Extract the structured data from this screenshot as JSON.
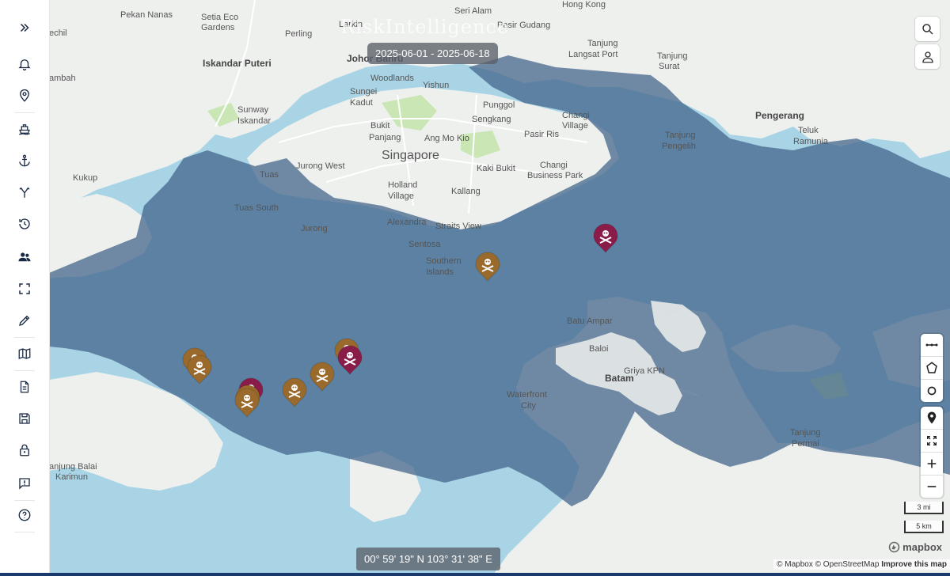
{
  "app": {
    "brand_watermark": "RiskIntelligence"
  },
  "filter": {
    "date_range": "2025-06-01 - 2025-06-18"
  },
  "sidebar": {
    "items": [
      {
        "name": "expand",
        "icon": "chevrons-right-icon"
      },
      {
        "name": "alerts",
        "icon": "bell-icon"
      },
      {
        "name": "locations",
        "icon": "map-pin-icon"
      },
      {
        "name": "vessels",
        "icon": "ship-icon"
      },
      {
        "name": "ports",
        "icon": "anchor-icon"
      },
      {
        "name": "routes",
        "icon": "branch-icon"
      },
      {
        "name": "history",
        "icon": "history-icon"
      },
      {
        "name": "users",
        "icon": "users-icon"
      },
      {
        "name": "fullscreen",
        "icon": "fullscreen-icon"
      },
      {
        "name": "draw",
        "icon": "pencil-icon"
      },
      {
        "name": "maps",
        "icon": "map-icon"
      },
      {
        "name": "reports",
        "icon": "document-icon"
      },
      {
        "name": "save",
        "icon": "save-icon"
      },
      {
        "name": "lock",
        "icon": "lock-icon"
      },
      {
        "name": "feedback",
        "icon": "feedback-icon"
      },
      {
        "name": "help",
        "icon": "help-icon"
      }
    ]
  },
  "map": {
    "place_labels": [
      {
        "text": "Pekan Nanas",
        "style": "normal"
      },
      {
        "text": "Setia Eco",
        "style": "normal"
      },
      {
        "text": "Gardens",
        "style": "normal"
      },
      {
        "text": "Larkin",
        "style": "normal"
      },
      {
        "text": "Seri Alam",
        "style": "normal"
      },
      {
        "text": "Pasir Gudang",
        "style": "normal"
      },
      {
        "text": "Hong Kong",
        "style": "normal"
      },
      {
        "text": "echil",
        "style": "normal"
      },
      {
        "text": "Perling",
        "style": "normal"
      },
      {
        "text": "Iskandar Puteri",
        "style": "bold"
      },
      {
        "text": "Johor Bahru",
        "style": "bold"
      },
      {
        "text": "Tanjung",
        "style": "normal"
      },
      {
        "text": "Langsat Port",
        "style": "normal"
      },
      {
        "text": "Tanjung",
        "style": "normal"
      },
      {
        "text": "Surat",
        "style": "normal"
      },
      {
        "text": "ambah",
        "style": "normal"
      },
      {
        "text": "Woodlands",
        "style": "normal"
      },
      {
        "text": "Yishun",
        "style": "normal"
      },
      {
        "text": "Sungei",
        "style": "normal"
      },
      {
        "text": "Kadut",
        "style": "normal"
      },
      {
        "text": "Punggol",
        "style": "normal"
      },
      {
        "text": "Sunway",
        "style": "normal"
      },
      {
        "text": "Iskandar",
        "style": "normal"
      },
      {
        "text": "Sengkang",
        "style": "normal"
      },
      {
        "text": "Changi",
        "style": "normal"
      },
      {
        "text": "Village",
        "style": "normal"
      },
      {
        "text": "Pengerang",
        "style": "bold"
      },
      {
        "text": "Bukit",
        "style": "normal"
      },
      {
        "text": "Panjang",
        "style": "normal"
      },
      {
        "text": "Ang Mo Kio",
        "style": "normal"
      },
      {
        "text": "Pasir Ris",
        "style": "normal"
      },
      {
        "text": "Teluk",
        "style": "normal"
      },
      {
        "text": "Ramunia",
        "style": "normal"
      },
      {
        "text": "Tanjung",
        "style": "normal"
      },
      {
        "text": "Pengelih",
        "style": "normal"
      },
      {
        "text": "Singapore",
        "style": "big"
      },
      {
        "text": "Jurong West",
        "style": "normal"
      },
      {
        "text": "Kaki Bukit",
        "style": "normal"
      },
      {
        "text": "Changi",
        "style": "normal"
      },
      {
        "text": "Business Park",
        "style": "normal"
      },
      {
        "text": "Kukup",
        "style": "normal"
      },
      {
        "text": "Tuas",
        "style": "normal"
      },
      {
        "text": "Holland",
        "style": "normal"
      },
      {
        "text": "Village",
        "style": "normal"
      },
      {
        "text": "Kallang",
        "style": "normal"
      },
      {
        "text": "Tuas South",
        "style": "normal"
      },
      {
        "text": "Jurong",
        "style": "normal"
      },
      {
        "text": "Alexandra",
        "style": "normal"
      },
      {
        "text": "Straits View",
        "style": "normal"
      },
      {
        "text": "Sentosa",
        "style": "normal"
      },
      {
        "text": "Southern",
        "style": "normal"
      },
      {
        "text": "Islands",
        "style": "normal"
      },
      {
        "text": "Batu Ampar",
        "style": "normal"
      },
      {
        "text": "Baloi",
        "style": "normal"
      },
      {
        "text": "Griya KPN",
        "style": "normal"
      },
      {
        "text": "Batam",
        "style": "bold"
      },
      {
        "text": "Waterfront",
        "style": "normal"
      },
      {
        "text": "City",
        "style": "normal"
      },
      {
        "text": "Tanjung",
        "style": "normal"
      },
      {
        "text": "Permai",
        "style": "normal"
      },
      {
        "text": "anjung Balai",
        "style": "normal"
      },
      {
        "text": "Karimun",
        "style": "normal"
      }
    ],
    "incident_markers": [
      {
        "type": "piracy",
        "color": "#8a1c4a"
      },
      {
        "type": "piracy",
        "color": "#9a6a2c"
      },
      {
        "type": "piracy",
        "color": "#9a6a2c"
      },
      {
        "type": "piracy",
        "color": "#9a6a2c"
      },
      {
        "type": "piracy",
        "color": "#8a1c4a"
      },
      {
        "type": "piracy",
        "color": "#9a6a2c"
      },
      {
        "type": "piracy",
        "color": "#9a6a2c"
      },
      {
        "type": "piracy",
        "color": "#9a6a2c"
      },
      {
        "type": "piracy",
        "color": "#8a1c4a"
      },
      {
        "type": "piracy",
        "color": "#9a6a2c"
      },
      {
        "type": "piracy",
        "color": "#9a6a2c"
      }
    ],
    "colors": {
      "water": "#a8d4e6",
      "land": "#eef0ee",
      "risk_zone": "#5a7a99",
      "park": "#c9e6b4",
      "marker_high": "#8a1c4a",
      "marker_medium": "#9a6a2c"
    }
  },
  "controls": {
    "search_icon": "search-icon",
    "user_icon": "user-icon",
    "measure_tools": [
      "measure-line-icon",
      "polygon-icon",
      "circle-icon"
    ],
    "nav_tools": [
      "locate-pin-icon",
      "fit-bounds-icon",
      "zoom-in-icon",
      "zoom-out-icon"
    ]
  },
  "scale": {
    "imperial": "3 mi",
    "metric": "5 km"
  },
  "coordinates": {
    "text": "00° 59' 19\" N 103° 31' 38\" E"
  },
  "attribution": {
    "mapbox": "© Mapbox",
    "osm": "© OpenStreetMap",
    "improve": "Improve this map",
    "logo": "mapbox"
  }
}
